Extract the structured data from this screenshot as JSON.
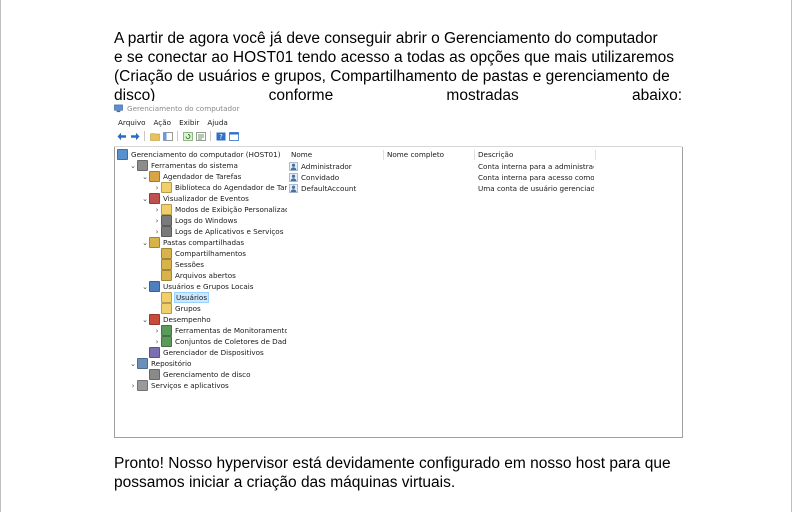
{
  "paragraph1": {
    "line1": "A partir de agora você já deve conseguir abrir o Gerenciamento do computador",
    "line2": "e se conectar ao HOST01 tendo acesso a todas as opções que mais utilizaremos",
    "line3": "(Criação de usuários e grupos, Compartilhamento de pastas e gerenciamento de",
    "line4_words": [
      "disco)",
      "conforme",
      "mostradas",
      "abaixo:"
    ]
  },
  "paragraph2": {
    "line1": "Pronto! Nosso hypervisor está devidamente configurado em nosso host para que",
    "line2": "possamos iniciar a criação das máquinas virtuais."
  },
  "window": {
    "title": "Gerenciamento do computador",
    "menu": [
      "Arquivo",
      "Ação",
      "Exibir",
      "Ajuda"
    ],
    "toolbar_icons": [
      "back-arrow-icon",
      "forward-arrow-icon",
      "up-folder-icon",
      "show-hide-tree-icon",
      "refresh-icon",
      "export-list-icon",
      "help-icon",
      "properties-icon"
    ]
  },
  "tree": [
    {
      "label": "Gerenciamento do computador (HOST01)",
      "caret": "",
      "icon": "computer"
    },
    {
      "label": "Ferramentas do sistema",
      "caret": "⌄",
      "icon": "tools"
    },
    {
      "label": "Agendador de Tarefas",
      "caret": "⌄",
      "icon": "clock"
    },
    {
      "label": "Biblioteca do Agendador de Tarefas",
      "caret": "›",
      "icon": "folder"
    },
    {
      "label": "Visualizador de Eventos",
      "caret": "⌄",
      "icon": "event"
    },
    {
      "label": "Modos de Exibição Personalizados",
      "caret": "›",
      "icon": "folder"
    },
    {
      "label": "Logs do Windows",
      "caret": "›",
      "icon": "log"
    },
    {
      "label": "Logs de Aplicativos e Serviços",
      "caret": "›",
      "icon": "log"
    },
    {
      "label": "Pastas compartilhadas",
      "caret": "⌄",
      "icon": "share"
    },
    {
      "label": "Compartilhamentos",
      "caret": "",
      "icon": "share"
    },
    {
      "label": "Sessões",
      "caret": "",
      "icon": "share"
    },
    {
      "label": "Arquivos abertos",
      "caret": "",
      "icon": "share"
    },
    {
      "label": "Usuários e Grupos Locais",
      "caret": "⌄",
      "icon": "users"
    },
    {
      "label": "Usuários",
      "caret": "",
      "icon": "folder",
      "selected": true
    },
    {
      "label": "Grupos",
      "caret": "",
      "icon": "folder"
    },
    {
      "label": "Desempenho",
      "caret": "⌄",
      "icon": "perf"
    },
    {
      "label": "Ferramentas de Monitoramento",
      "caret": "›",
      "icon": "monitor"
    },
    {
      "label": "Conjuntos de Coletores de Dados",
      "caret": "›",
      "icon": "monitor"
    },
    {
      "label": "Gerenciador de Dispositivos",
      "caret": "",
      "icon": "device"
    },
    {
      "label": "Repositório",
      "caret": "⌄",
      "icon": "storage"
    },
    {
      "label": "Gerenciamento de disco",
      "caret": "",
      "icon": "disk"
    },
    {
      "label": "Serviços e aplicativos",
      "caret": "›",
      "icon": "services"
    }
  ],
  "list": {
    "columns": [
      "Nome",
      "Nome completo",
      "Descrição"
    ],
    "rows": [
      {
        "name": "Administrador",
        "fullname": "",
        "desc": "Conta interna para a administraçã..."
      },
      {
        "name": "Convidado",
        "fullname": "",
        "desc": "Conta interna para acesso como c..."
      },
      {
        "name": "DefaultAccount",
        "fullname": "",
        "desc": "Uma conta de usuário gerenciada..."
      }
    ]
  }
}
